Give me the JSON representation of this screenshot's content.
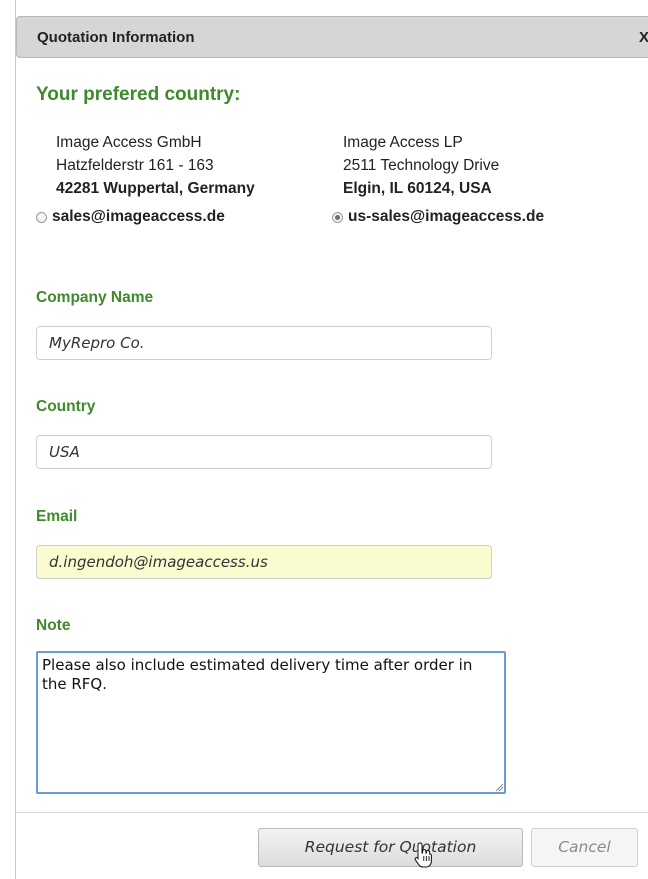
{
  "dialog": {
    "title": "Quotation Information",
    "close_label": "X",
    "heading": "Your prefered country:"
  },
  "offices": [
    {
      "company": "Image Access GmbH",
      "street": "Hatzfelderstr 161 - 163",
      "city": "42281 Wuppertal, Germany",
      "email": "sales@imageaccess.de",
      "selected": false
    },
    {
      "company": "Image Access LP",
      "street": "2511 Technology Drive",
      "city": "Elgin, IL 60124, USA",
      "email": "us-sales@imageaccess.de",
      "selected": true
    }
  ],
  "form": {
    "company_label": "Company Name",
    "company_value": "MyRepro Co.",
    "country_label": "Country",
    "country_value": "USA",
    "email_label": "Email",
    "email_value": "d.ingendoh@imageaccess.us",
    "note_label": "Note",
    "note_value": "Please also include estimated delivery time after order in the RFQ."
  },
  "buttons": {
    "request_label": "Request for Quotation",
    "cancel_label": "Cancel"
  },
  "colors": {
    "accent_green": "#3f8a2a",
    "autofill_yellow": "#fbfbd0",
    "focus_blue": "#6a9bd8"
  },
  "icons": {
    "cursor": "hand-pointer-icon",
    "resize": "resize-grip-icon"
  }
}
